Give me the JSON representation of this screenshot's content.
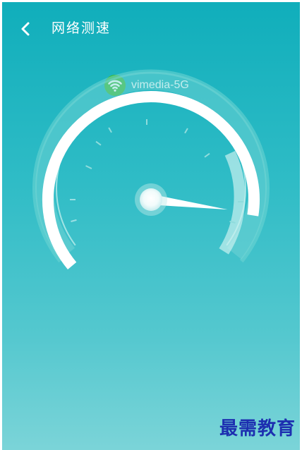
{
  "header": {
    "title": "网络测速",
    "back_icon": "chevron-left-icon"
  },
  "network": {
    "ssid": "vimedia-5G",
    "icon": "wifi-icon",
    "icon_color": "#3dbb3d"
  },
  "gauge": {
    "needle_level": 0.86,
    "progress_level": 0.88
  },
  "watermark": {
    "text": "最需教育"
  },
  "colors": {
    "background_top": "#10aebb",
    "background_bottom": "#7bd4d8",
    "text": "#ffffff",
    "watermark": "#1d2fb0"
  }
}
